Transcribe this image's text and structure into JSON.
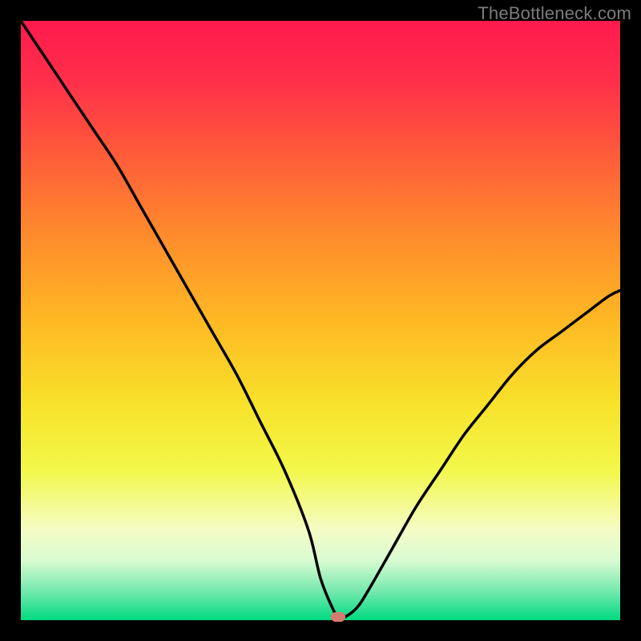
{
  "watermark": "TheBottleneck.com",
  "chart_data": {
    "type": "line",
    "title": "",
    "xlabel": "",
    "ylabel": "",
    "xlim": [
      0,
      100
    ],
    "ylim": [
      0,
      100
    ],
    "grid": false,
    "legend": false,
    "series": [
      {
        "name": "curve",
        "x": [
          0,
          4,
          8,
          12,
          16,
          20,
          24,
          28,
          32,
          36,
          40,
          44,
          48,
          50,
          52,
          53,
          54,
          56,
          58,
          62,
          66,
          70,
          74,
          78,
          82,
          86,
          90,
          94,
          98,
          100
        ],
        "y": [
          100,
          94,
          88,
          82,
          76,
          69,
          62,
          55,
          48,
          41,
          33,
          25,
          15,
          7,
          2,
          0.5,
          0.5,
          2,
          5,
          12,
          19,
          25,
          31,
          36,
          41,
          45,
          48,
          51,
          54,
          55
        ]
      }
    ],
    "minimum_marker": {
      "x": 53,
      "y": 0.5
    },
    "colors": {
      "curve": "#000000",
      "marker": "#d77a6f",
      "gradient_stops": [
        {
          "pos": 0.0,
          "hex": "#ff1a4d"
        },
        {
          "pos": 0.22,
          "hex": "#ff5a3a"
        },
        {
          "pos": 0.5,
          "hex": "#ffb824"
        },
        {
          "pos": 0.75,
          "hex": "#f2f84a"
        },
        {
          "pos": 0.9,
          "hex": "#d9fbd1"
        },
        {
          "pos": 1.0,
          "hex": "#00d980"
        }
      ]
    }
  }
}
